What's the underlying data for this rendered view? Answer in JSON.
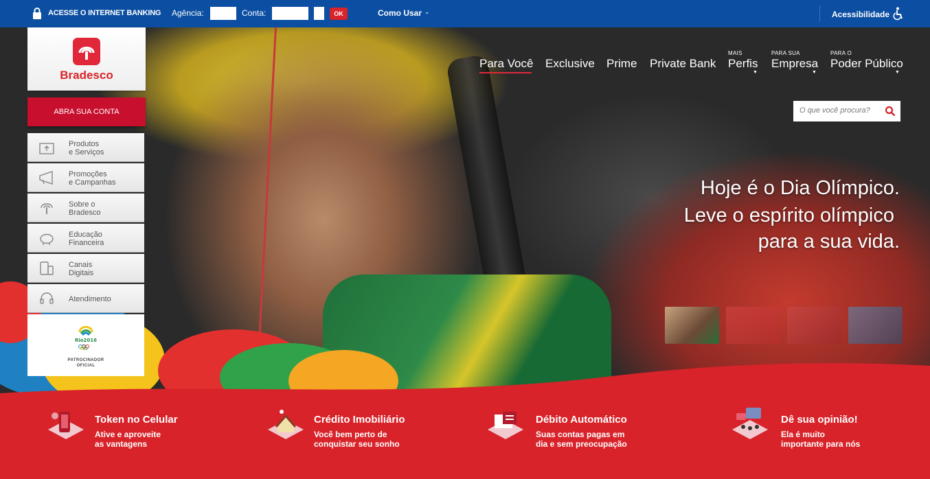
{
  "topbar": {
    "internet_banking_label": "ACESSE O INTERNET BANKING",
    "agencia_label": "Agência:",
    "conta_label": "Conta:",
    "ok_label": "OK",
    "como_usar_label": "Como Usar",
    "acessibilidade_label": "Acessibilidade"
  },
  "brand": {
    "name": "Bradesco",
    "color": "#d8232a"
  },
  "nav": {
    "para_voce": "Para Você",
    "exclusive": "Exclusive",
    "prime": "Prime",
    "private_bank": "Private Bank",
    "mais_small": "MAIS",
    "perfis": "Perfis",
    "empresa_small": "PARA SUA",
    "empresa": "Empresa",
    "poder_small": "PARA O",
    "poder_publico": "Poder Público"
  },
  "search": {
    "placeholder": "O que você procura?"
  },
  "hero": {
    "line1": "Hoje é o Dia Olímpico.",
    "line2": "Leve o espírito olímpico",
    "line3": "para a sua vida."
  },
  "sidebar": {
    "open_account": "ABRA SUA CONTA",
    "items": [
      {
        "line1": "Produtos",
        "line2": "e Serviços",
        "icon": "box-icon"
      },
      {
        "line1": "Promoções",
        "line2": "e Campanhas",
        "icon": "megaphone-icon"
      },
      {
        "line1": "Sobre o",
        "line2": "Bradesco",
        "icon": "bradesco-tree-icon"
      },
      {
        "line1": "Educação",
        "line2": "Financeira",
        "icon": "piggy-bank-icon"
      },
      {
        "line1": "Canais",
        "line2": "Digitais",
        "icon": "devices-icon"
      },
      {
        "line1": "Atendimento",
        "line2": "",
        "icon": "headset-icon"
      }
    ],
    "sponsor_line1": "PATROCINADOR",
    "sponsor_line2": "OFICIAL"
  },
  "features": [
    {
      "title": "Token no Celular",
      "line1": "Ative e aproveite",
      "line2": "as vantagens",
      "icon": "phone-token-icon"
    },
    {
      "title": "Crédito Imobiliário",
      "line1": "Você bem perto de",
      "line2": "conquistar seu sonho",
      "icon": "house-icon"
    },
    {
      "title": "Débito Automático",
      "line1": "Suas contas pagas em",
      "line2": "dia e sem preocupação",
      "icon": "automatic-debit-icon"
    },
    {
      "title": "Dê sua opinião!",
      "line1": "Ela é muito",
      "line2": "importante para nós",
      "icon": "opinion-icon"
    }
  ]
}
